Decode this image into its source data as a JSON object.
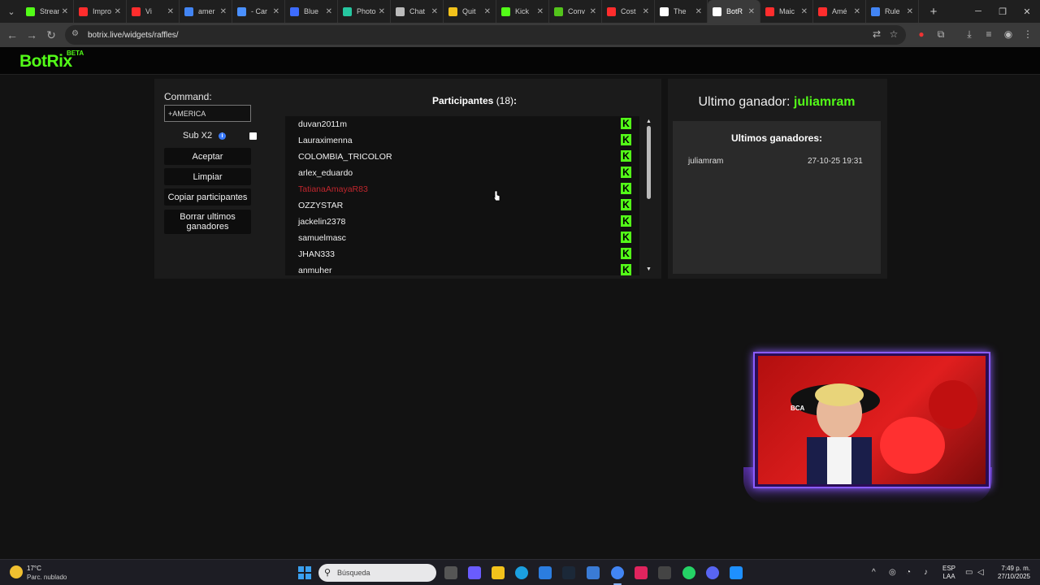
{
  "browser": {
    "tabs": [
      {
        "title": "Stream",
        "color": "#53fc18"
      },
      {
        "title": "Impro",
        "color": "#ff2d2d"
      },
      {
        "title": "Vi",
        "color": "#ff2d2d"
      },
      {
        "title": "amer",
        "color": "#4285f4"
      },
      {
        "title": "- Car",
        "color": "#4a90ff"
      },
      {
        "title": "Blue",
        "color": "#3d6cff"
      },
      {
        "title": "Photo",
        "color": "#26c6a0"
      },
      {
        "title": "Chat",
        "color": "#bbbbbb"
      },
      {
        "title": "Quit",
        "color": "#f2c21b"
      },
      {
        "title": "Kick",
        "color": "#53fc18"
      },
      {
        "title": "Conv",
        "color": "#53c41b"
      },
      {
        "title": "Cost",
        "color": "#ff2d2d"
      },
      {
        "title": "The",
        "color": "#ffffff"
      },
      {
        "title": "BotR",
        "color": "#ffffff"
      },
      {
        "title": "Maic",
        "color": "#ff2d2d"
      },
      {
        "title": "Amé",
        "color": "#ff2d2d"
      },
      {
        "title": "Rule",
        "color": "#4285f4"
      }
    ],
    "active_tab_index": 13,
    "url": "botrix.live/widgets/raffles/"
  },
  "site": {
    "logo": "BotRix",
    "beta": "BETA"
  },
  "controls": {
    "command_label": "Command:",
    "command_value": "+AMERICA",
    "subx2_label": "Sub X2",
    "subx2_checked": false,
    "accept_label": "Aceptar",
    "clear_label": "Limpiar",
    "copy_label": "Copiar participantes",
    "delete_label": "Borrar ultimos ganadores"
  },
  "participants": {
    "title": "Participantes",
    "count": "(18)",
    "colon": ":",
    "list": [
      {
        "name": "duvan2011m",
        "highlight": false
      },
      {
        "name": "Lauraximenna",
        "highlight": false
      },
      {
        "name": "COLOMBIA_TRICOLOR",
        "highlight": false
      },
      {
        "name": "arlex_eduardo",
        "highlight": false
      },
      {
        "name": "TatianaAmayaR83",
        "highlight": true
      },
      {
        "name": "OZZYSTAR",
        "highlight": false
      },
      {
        "name": "jackelin2378",
        "highlight": false
      },
      {
        "name": "samuelmasc",
        "highlight": false
      },
      {
        "name": "JHAN333",
        "highlight": false
      },
      {
        "name": "anmuher",
        "highlight": false
      }
    ]
  },
  "winner": {
    "label": "Ultimo ganador:",
    "name": "juliamram",
    "history_title": "Ultimos ganadores:",
    "history": [
      {
        "name": "juliamram",
        "date": "27-10-25 19:31"
      }
    ]
  },
  "webcam": {
    "text_left": "BCA"
  },
  "taskbar": {
    "temp": "17°C",
    "weather": "Parc. nublado",
    "search_placeholder": "Búsqueda",
    "lang_top": "ESP",
    "lang_bottom": "LAA",
    "time": "7:49 p. m.",
    "date": "27/10/2025"
  },
  "colors": {
    "kick_green": "#53fc18",
    "highlight_red": "#c0262d"
  }
}
